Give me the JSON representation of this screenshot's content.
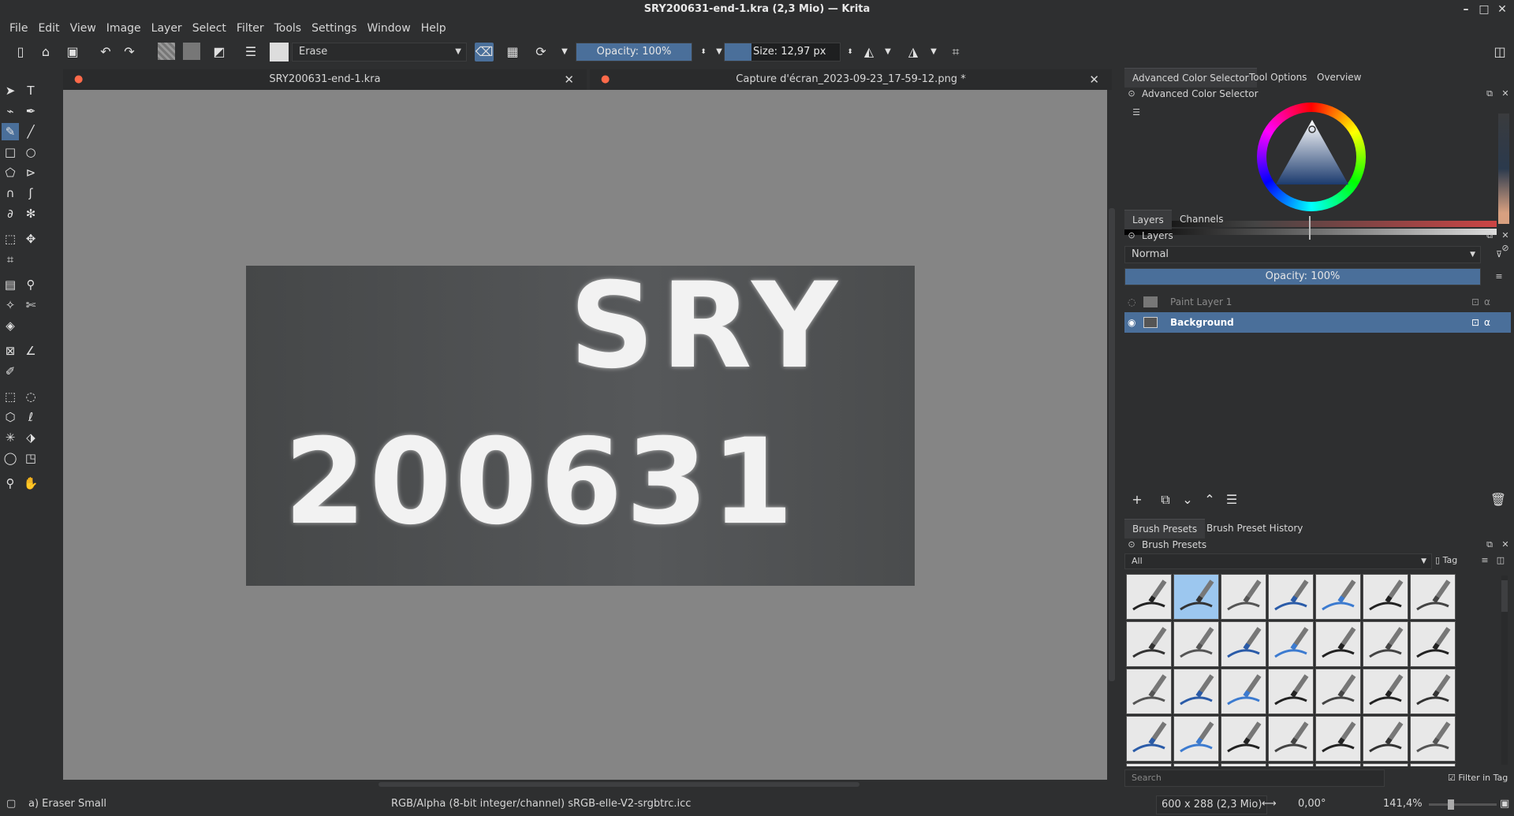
{
  "window": {
    "title": "SRY200631-end-1.kra (2,3 Mio) — Krita"
  },
  "menu": [
    "File",
    "Edit",
    "View",
    "Image",
    "Layer",
    "Select",
    "Filter",
    "Tools",
    "Settings",
    "Window",
    "Help"
  ],
  "toolbar": {
    "brush_preset": "Erase",
    "opacity": "Opacity: 100%",
    "size": "Size: 12,97 px"
  },
  "tabs": [
    {
      "label": "SRY200631-end-1.kra"
    },
    {
      "label": "Capture d'écran_2023-09-23_17-59-12.png *"
    }
  ],
  "canvas": {
    "line1": "SRY",
    "line2": "200631"
  },
  "dock": {
    "top_tabs": [
      "Advanced Color Selector",
      "Tool Options",
      "Overview"
    ],
    "color_selector_title": "Advanced Color Selector",
    "layer_tabs": [
      "Layers",
      "Channels"
    ],
    "layers_title": "Layers",
    "blend_mode": "Normal",
    "layer_opacity": "Opacity:  100%",
    "layers": [
      {
        "name": "Paint Layer 1",
        "selected": false
      },
      {
        "name": "Background",
        "selected": true
      }
    ],
    "preset_tabs": [
      "Brush Presets",
      "Brush Preset History"
    ],
    "presets_title": "Brush Presets",
    "preset_filter": "All",
    "tag_label": "Tag",
    "search_placeholder": "Search",
    "filter_in_tag": "Filter in Tag"
  },
  "status": {
    "brush": "a) Eraser Small",
    "color_model": "RGB/Alpha (8-bit integer/channel)  sRGB-elle-V2-srgbtrc.icc",
    "dimensions": "600 x 288 (2,3 Mio)",
    "rotation": "0,00°",
    "zoom": "141,4%"
  },
  "colors": {
    "accent": "#4a6f9a",
    "selected_layer": "#4a6f9a"
  }
}
